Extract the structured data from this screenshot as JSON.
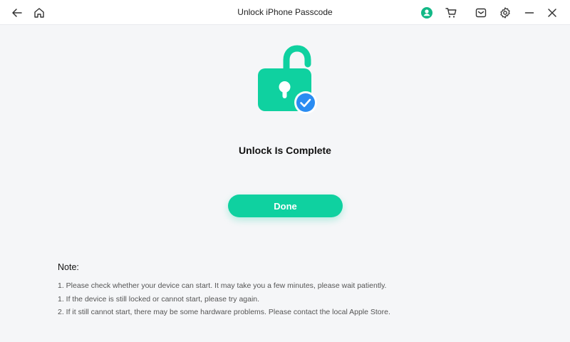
{
  "window": {
    "title": "Unlock iPhone Passcode"
  },
  "toolbar": {
    "icons": [
      "back-arrow-icon",
      "home-icon",
      "account-icon",
      "cart-icon",
      "mail-icon",
      "gear-icon",
      "minimize-icon",
      "close-icon"
    ]
  },
  "colors": {
    "accent": "#0fd1a0",
    "check_badge": "#2a8cf2",
    "account_icon": "#12b886"
  },
  "status": {
    "heading": "Unlock Is Complete",
    "icon": "unlocked-padlock-with-check-icon"
  },
  "actions": {
    "done_label": "Done"
  },
  "notes": {
    "title": "Note:",
    "items": [
      "1. Please check whether your device can start. It may take you a few minutes, please wait patiently.",
      "1. If the device is still locked or cannot start, please try again.",
      "2. If it still cannot start, there may be some hardware problems. Please contact the local Apple Store."
    ]
  }
}
